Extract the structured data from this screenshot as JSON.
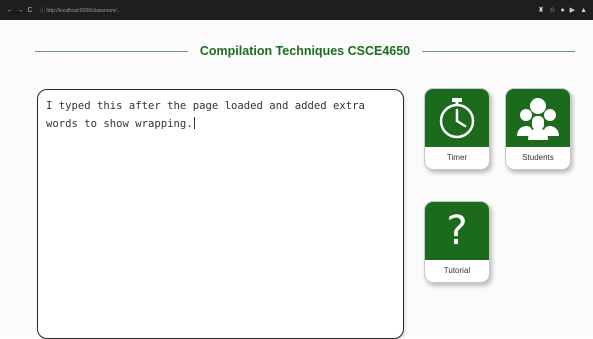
{
  "browser": {
    "nav": [
      "←",
      "→",
      "C"
    ],
    "address": "ⓘ http://localhost:8000/classroom/...",
    "right_icons": [
      "♜",
      "☆",
      "●",
      "▶",
      "▲"
    ]
  },
  "header": {
    "title": "Compilation Techniques CSCE4650"
  },
  "editor": {
    "text": "I typed this after the page loaded and added extra words to show wrapping."
  },
  "tiles": [
    {
      "id": "timer",
      "label": "Timer",
      "icon": "stopwatch-icon"
    },
    {
      "id": "students",
      "label": "Students",
      "icon": "people-icon"
    },
    {
      "id": "tutorial",
      "label": "Tutorial",
      "icon": "question-mark-icon",
      "glyph": "?"
    }
  ],
  "colors": {
    "accent": "#1c6a1c",
    "title": "#1f6b1f",
    "browser_bar": "#1e1e1e"
  }
}
